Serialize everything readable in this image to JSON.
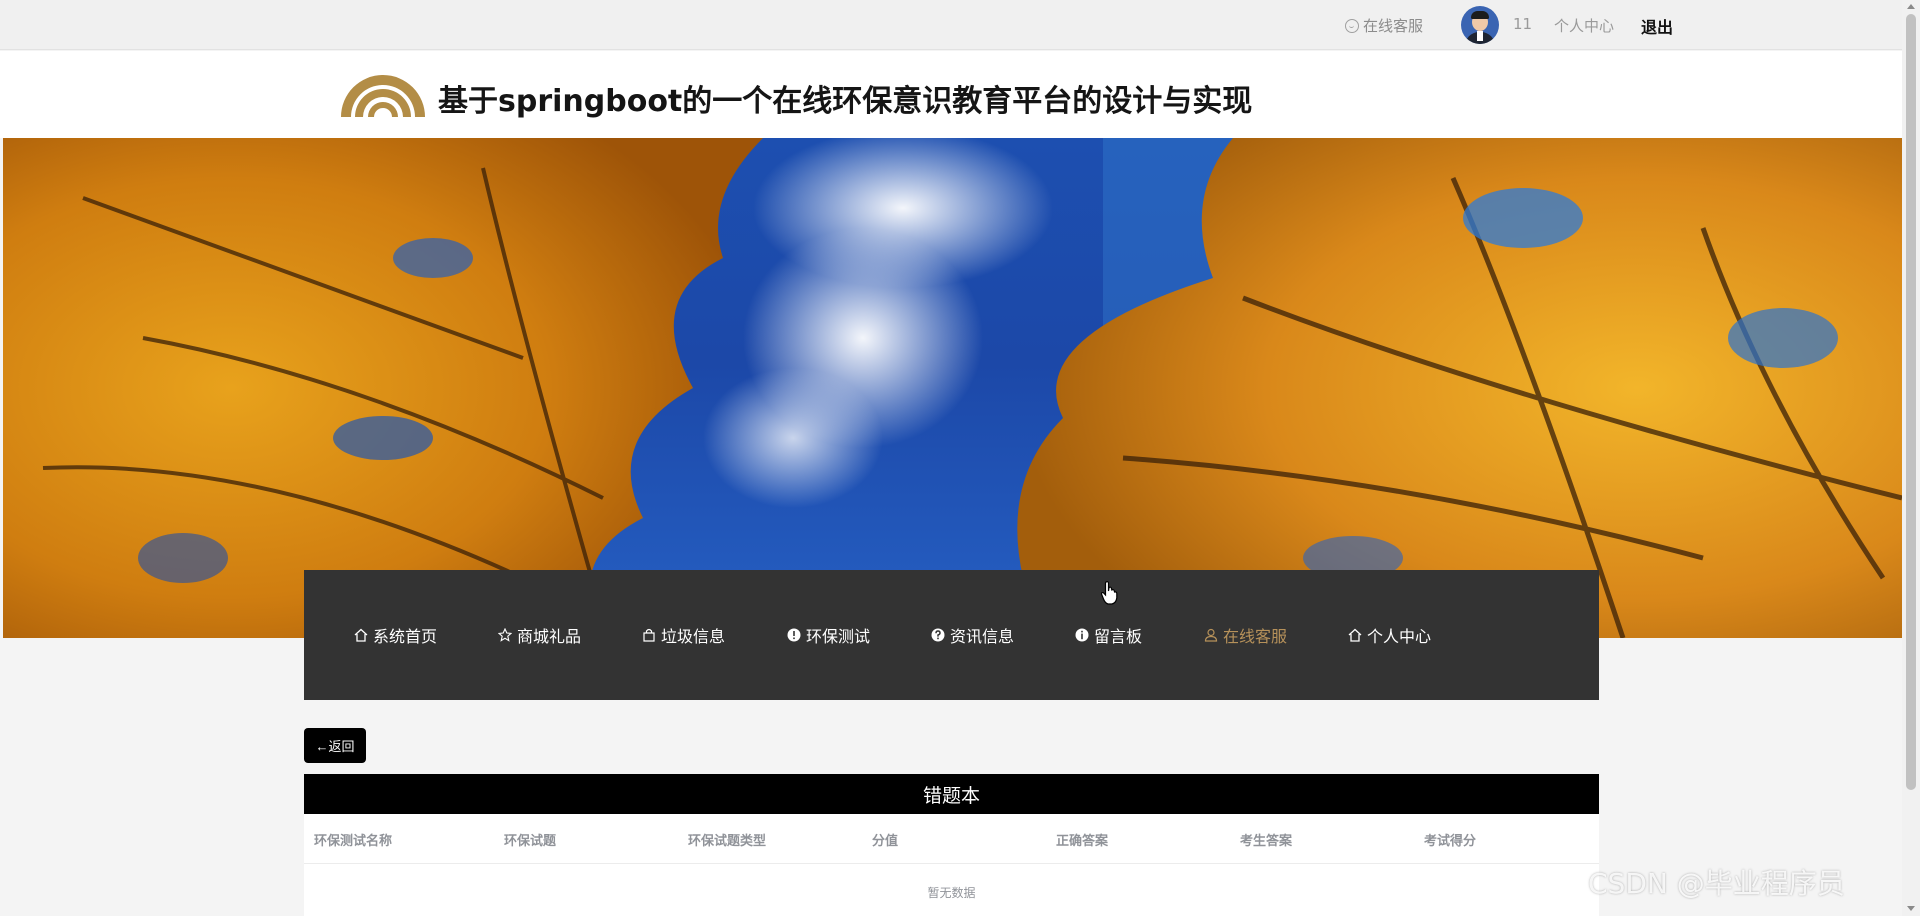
{
  "topbar": {
    "service_label": "在线客服",
    "username": "11",
    "user_center": "个人中心",
    "logout": "退出"
  },
  "header": {
    "title": "基于springboot的一个在线环保意识教育平台的设计与实现"
  },
  "nav": {
    "items": [
      {
        "label": "系统首页",
        "icon": "home-icon"
      },
      {
        "label": "商城礼品",
        "icon": "star-icon"
      },
      {
        "label": "垃圾信息",
        "icon": "bag-icon"
      },
      {
        "label": "环保测试",
        "icon": "exclamation-icon"
      },
      {
        "label": "资讯信息",
        "icon": "question-icon"
      },
      {
        "label": "留言板",
        "icon": "info-icon"
      },
      {
        "label": "在线客服",
        "icon": "user-icon"
      },
      {
        "label": "个人中心",
        "icon": "home-icon"
      }
    ],
    "active_index": 6
  },
  "content": {
    "back_label": "←返回",
    "book_title": "错题本",
    "columns": [
      "环保测试名称",
      "环保试题",
      "环保试题类型",
      "分值",
      "正确答案",
      "考生答案",
      "考试得分"
    ],
    "empty_text": "暂无数据"
  },
  "watermark": "CSDN @毕业程序员",
  "colors": {
    "nav_bg": "#333333",
    "nav_active": "#b6915a",
    "logo_gold": "#b38d46",
    "title_bar_bg": "#000000"
  }
}
